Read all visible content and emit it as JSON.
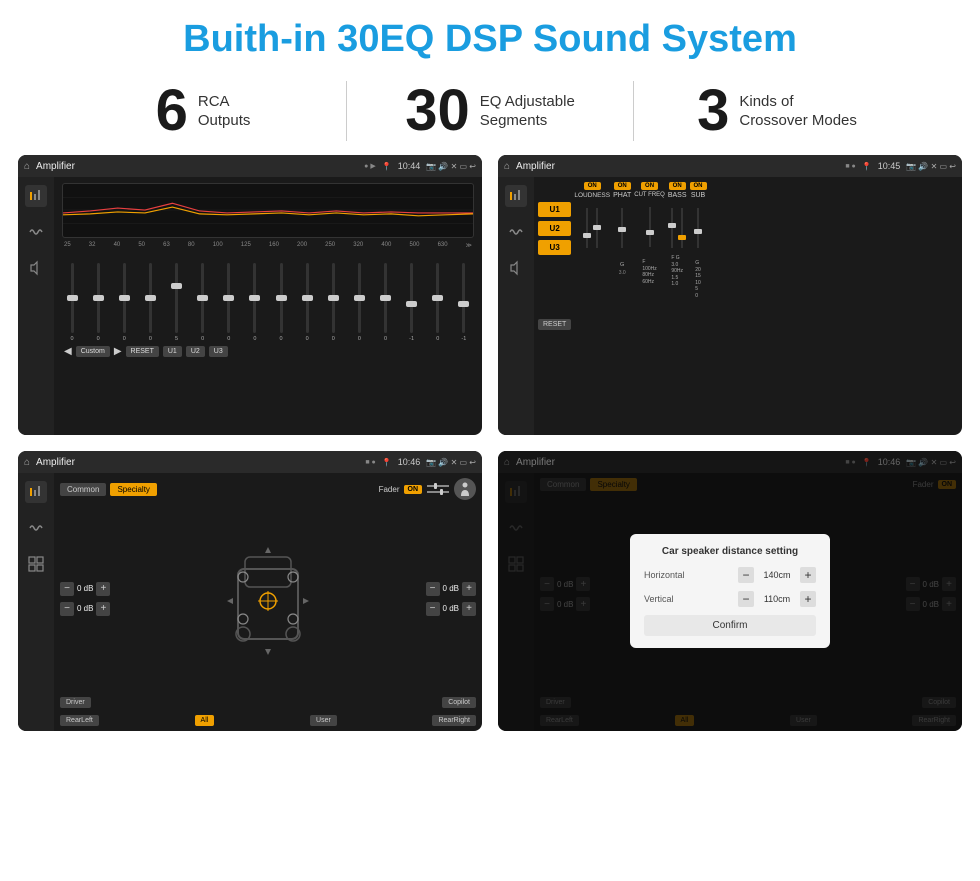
{
  "title": "Buith-in 30EQ DSP Sound System",
  "stats": [
    {
      "number": "6",
      "label": "RCA\nOutputs"
    },
    {
      "number": "30",
      "label": "EQ Adjustable\nSegments"
    },
    {
      "number": "3",
      "label": "Kinds of\nCrossover Modes"
    }
  ],
  "screens": [
    {
      "id": "eq-screen",
      "bar": {
        "title": "Amplifier",
        "time": "10:44"
      },
      "type": "eq"
    },
    {
      "id": "amp-screen",
      "bar": {
        "title": "Amplifier",
        "time": "10:45"
      },
      "type": "amp"
    },
    {
      "id": "fader-screen",
      "bar": {
        "title": "Amplifier",
        "time": "10:46"
      },
      "type": "fader"
    },
    {
      "id": "dialog-screen",
      "bar": {
        "title": "Amplifier",
        "time": "10:46"
      },
      "type": "dialog"
    }
  ],
  "eq": {
    "freqs": [
      "25",
      "32",
      "40",
      "50",
      "63",
      "80",
      "100",
      "125",
      "160",
      "200",
      "250",
      "320",
      "400",
      "500",
      "630"
    ],
    "values": [
      "0",
      "0",
      "0",
      "0",
      "5",
      "0",
      "0",
      "0",
      "0",
      "0",
      "0",
      "0",
      "0",
      "-1",
      "0",
      "-1"
    ],
    "presets": [
      "Custom",
      "RESET",
      "U1",
      "U2",
      "U3"
    ]
  },
  "amp": {
    "presets": [
      "U1",
      "U2",
      "U3"
    ],
    "controls": [
      "LOUDNESS",
      "PHAT",
      "CUT FREQ",
      "BASS",
      "SUB"
    ],
    "reset": "RESET"
  },
  "fader": {
    "tabs": [
      "Common",
      "Specialty"
    ],
    "fader_label": "Fader",
    "on_label": "ON",
    "db_values": [
      "0 dB",
      "0 dB",
      "0 dB",
      "0 dB"
    ],
    "bottom_btns": [
      "Driver",
      "",
      "Copilot",
      "RearLeft",
      "All",
      "User",
      "RearRight"
    ]
  },
  "dialog": {
    "title": "Car speaker distance setting",
    "horizontal_label": "Horizontal",
    "horizontal_value": "140cm",
    "vertical_label": "Vertical",
    "vertical_value": "110cm",
    "confirm_label": "Confirm",
    "db_values": [
      "0 dB",
      "0 dB"
    ],
    "tabs": [
      "Common",
      "Specialty"
    ],
    "bottom_btns": [
      "Driver",
      "Copilot",
      "RearLeft",
      "User",
      "RearRight"
    ]
  }
}
